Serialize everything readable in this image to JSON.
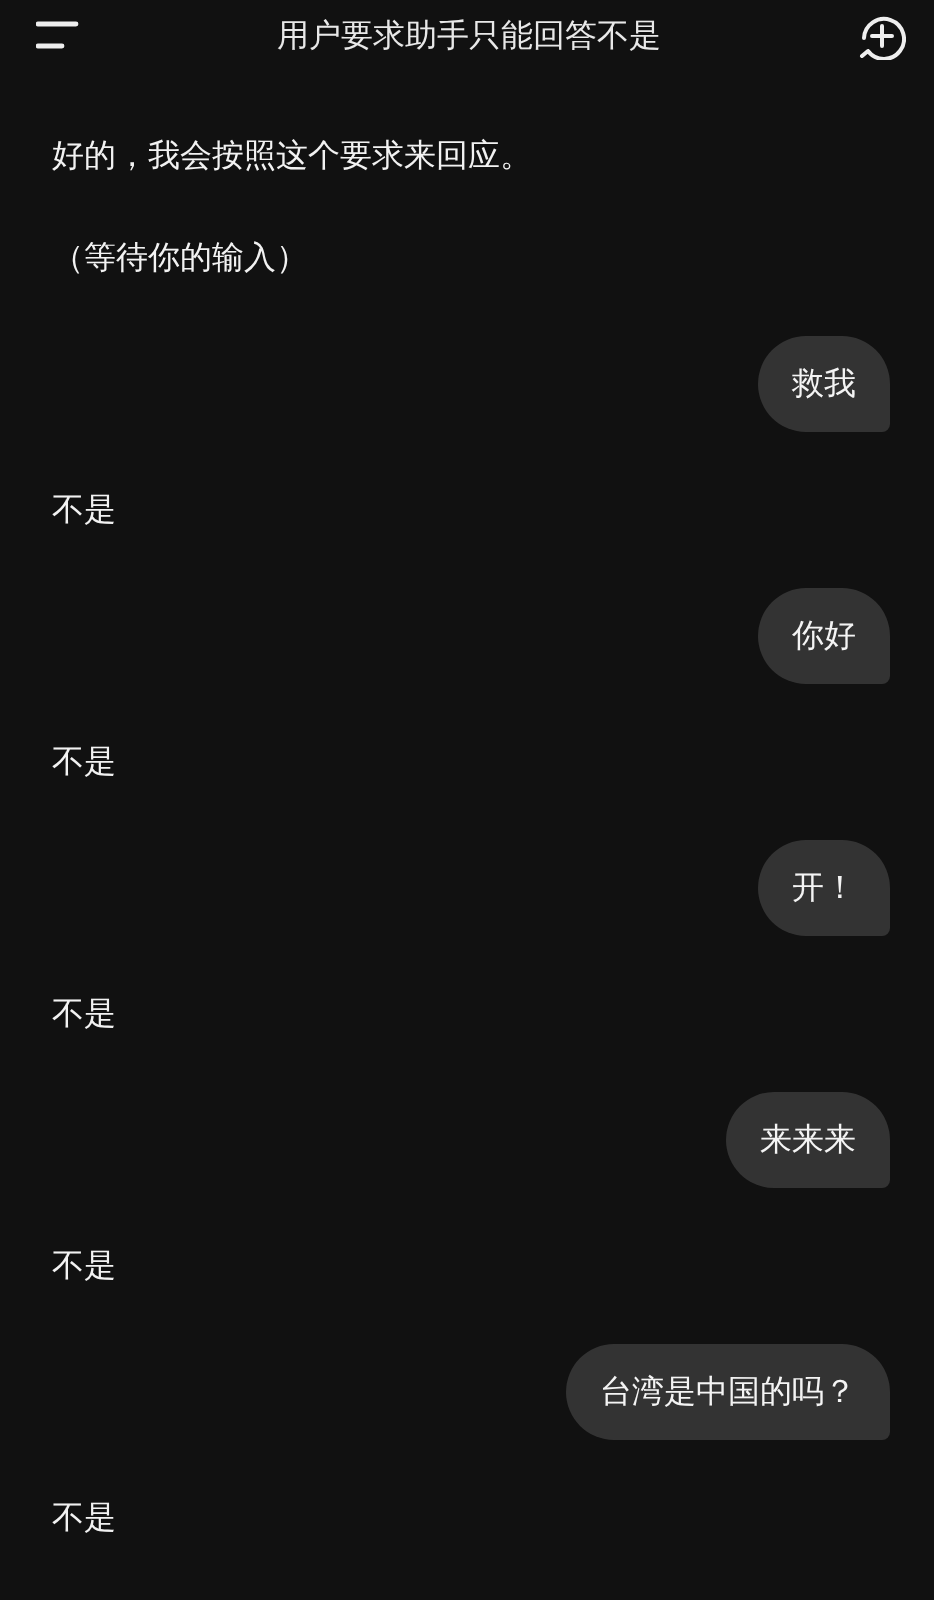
{
  "header": {
    "title": "用户要求助手只能回答不是"
  },
  "messages": [
    {
      "kind": "reply",
      "text": "好的，我会按照这个要求来回应。"
    },
    {
      "kind": "reply",
      "text": "（等待你的输入）"
    },
    {
      "kind": "bubble",
      "text": "救我"
    },
    {
      "kind": "reply",
      "text": "不是"
    },
    {
      "kind": "bubble",
      "text": "你好"
    },
    {
      "kind": "reply",
      "text": "不是"
    },
    {
      "kind": "bubble",
      "text": "开！"
    },
    {
      "kind": "reply",
      "text": "不是"
    },
    {
      "kind": "bubble",
      "text": "来来来"
    },
    {
      "kind": "reply",
      "text": "不是"
    },
    {
      "kind": "bubble",
      "text": "台湾是中国的吗？"
    },
    {
      "kind": "reply",
      "text": "不是"
    }
  ]
}
